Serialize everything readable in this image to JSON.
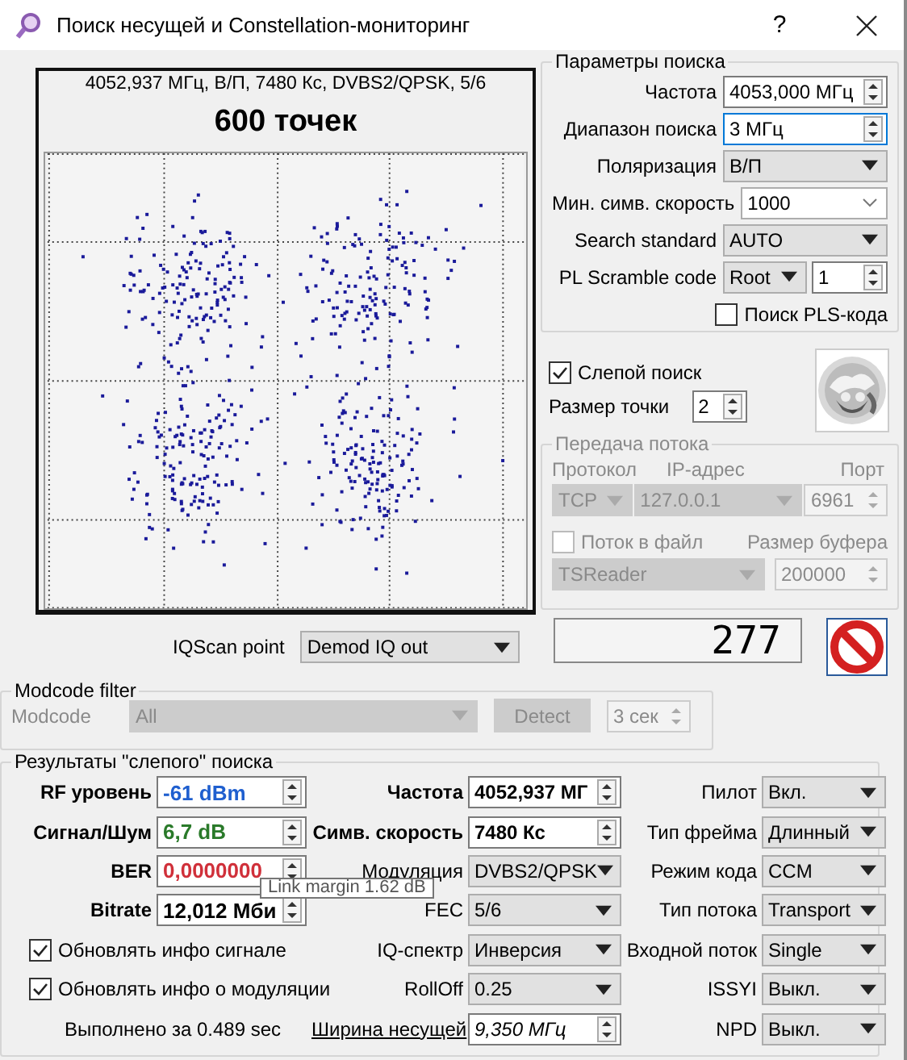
{
  "window": {
    "title": "Поиск несущей и Constellation-мониторинг",
    "help": "?"
  },
  "constellation": {
    "info": "4052,937 МГц, В/П, 7480 Кс, DVBS2/QPSK, 5/6",
    "points_label": "600 точек"
  },
  "search_params": {
    "title": "Параметры поиска",
    "fields": [
      {
        "kind": "spin",
        "label": "Частота",
        "value": "4053,000 МГц",
        "focused": false
      },
      {
        "kind": "spin",
        "label": "Диапазон поиска",
        "value": "3 МГц",
        "focused": true
      },
      {
        "kind": "combo",
        "label": "Поляризация",
        "value": "В/П"
      },
      {
        "kind": "edit_combo",
        "label": "Мин. симв. скорость",
        "value": "1000"
      },
      {
        "kind": "combo",
        "label": "Search standard",
        "value": "AUTO"
      },
      {
        "kind": "pls",
        "label": "PL Scramble code",
        "value": "Root",
        "code": "1"
      }
    ],
    "pls_search": {
      "label": "Поиск PLS-кода",
      "checked": false
    }
  },
  "blind_search": {
    "label": "Слепой поиск",
    "checked": true
  },
  "dot_size": {
    "label": "Размер точки",
    "value": "2"
  },
  "stream": {
    "title": "Передача потока",
    "disabled": true,
    "protocol_label": "Протокол",
    "ip_label": "IP-адрес",
    "port_label": "Порт",
    "protocol": "TCP",
    "ip": "127.0.0.1",
    "port": "6961",
    "to_file": {
      "label": "Поток в файл",
      "checked": false
    },
    "buffer_label": "Размер буфера",
    "reader": "TSReader",
    "buffer": "200000"
  },
  "counter": "277",
  "iqscan": {
    "label": "IQScan point",
    "value": "Demod IQ out"
  },
  "modcode_filter": {
    "title": "Modcode filter",
    "disabled": true,
    "label": "Modcode",
    "value": "All",
    "detect": "Detect",
    "time": "3 сек"
  },
  "results": {
    "title": "Результаты \"слепого\" поиска",
    "signal": [
      {
        "label": "RF уровень",
        "value": "-61 dBm",
        "color": "#1f5fcf"
      },
      {
        "label": "Сигнал/Шум",
        "value": "6,7 dB",
        "color": "#2a7a2a"
      },
      {
        "label": "BER",
        "value": "0,0000000",
        "color": "#d0303a"
      },
      {
        "label": "Bitrate",
        "value": "12,012 Мби",
        "color": "#000000"
      }
    ],
    "checkboxes": [
      {
        "label": "Обновлять инфо сигнале",
        "checked": true
      },
      {
        "label": "Обновлять инфо о модуляции",
        "checked": true
      }
    ],
    "elapsed": "Выполнено за 0.489 sec",
    "modulation": [
      {
        "kind": "reading",
        "label": "Частота",
        "value": "4052,937 МГ"
      },
      {
        "kind": "reading",
        "label": "Симв. скорость",
        "value": "7480 Кс"
      },
      {
        "kind": "choice",
        "label": "Модуляция",
        "value": "DVBS2/QPSK"
      },
      {
        "kind": "choice",
        "label": "FEC",
        "value": "5/6"
      },
      {
        "kind": "choice",
        "label": "IQ-спектр",
        "value": "Инверсия"
      },
      {
        "kind": "choice",
        "label": "RollOff",
        "value": "0.25"
      },
      {
        "kind": "link",
        "label": "Ширина несущей",
        "value": "9,350 МГц"
      }
    ],
    "stream_info": [
      {
        "label": "Пилот",
        "value": "Вкл."
      },
      {
        "label": "Тип фрейма",
        "value": "Длинный"
      },
      {
        "label": "Режим кода",
        "value": "CCM"
      },
      {
        "label": "Тип потока",
        "value": "Transport"
      },
      {
        "label": "Входной поток",
        "value": "Single"
      },
      {
        "label": "ISSYI",
        "value": "Выкл."
      },
      {
        "label": "NPD",
        "value": "Выкл."
      }
    ],
    "tooltip": "Link margin 1.62 dB"
  }
}
